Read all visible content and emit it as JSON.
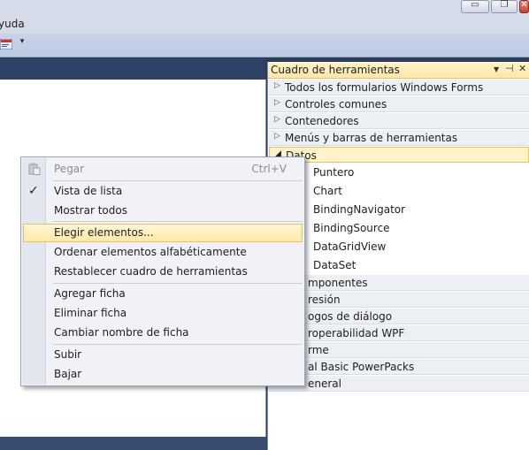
{
  "menubar": {
    "visible_fragment": "yuda"
  },
  "window_controls": {
    "minimize": "▭",
    "restore": "❐",
    "close": "✕"
  },
  "toolbar": {
    "overflow_glyph": "▾"
  },
  "toolbox": {
    "title": "Cuadro de herramientas",
    "controls": {
      "dropdown": "▼",
      "pin": "⊣",
      "close": "✕"
    },
    "groups_above": [
      "Todos los formularios Windows Forms",
      "Controles comunes",
      "Contenedores",
      "Menús y barras de herramientas"
    ],
    "expanded_group": "Datos",
    "tools": [
      "Puntero",
      "Chart",
      "BindingNavigator",
      "BindingSource",
      "DataGridView",
      "DataSet"
    ],
    "groups_below_visible": [
      "mponentes",
      "resión",
      "ogos de diálogo",
      "roperabilidad WPF",
      "rme",
      "al Basic PowerPacks",
      "eneral"
    ]
  },
  "context_menu": {
    "items": [
      {
        "label": "Pegar",
        "shortcut": "Ctrl+V",
        "disabled": true
      },
      {
        "label": "Vista de lista",
        "checked": true
      },
      {
        "label": "Mostrar todos"
      },
      {
        "label": "Elegir elementos...",
        "highlighted": true
      },
      {
        "label": "Ordenar elementos alfabéticamente"
      },
      {
        "label": "Restablecer cuadro de herramientas"
      },
      {
        "label": "Agregar ficha"
      },
      {
        "label": "Eliminar ficha"
      },
      {
        "label": "Cambiar nombre de ficha"
      },
      {
        "label": "Subir"
      },
      {
        "label": "Bajar"
      }
    ],
    "check_glyph": "✓"
  },
  "colors": {
    "highlight": "#ffe9a8",
    "panel_bg": "#2b3c59",
    "menu_bg": "#f0f2f6"
  }
}
